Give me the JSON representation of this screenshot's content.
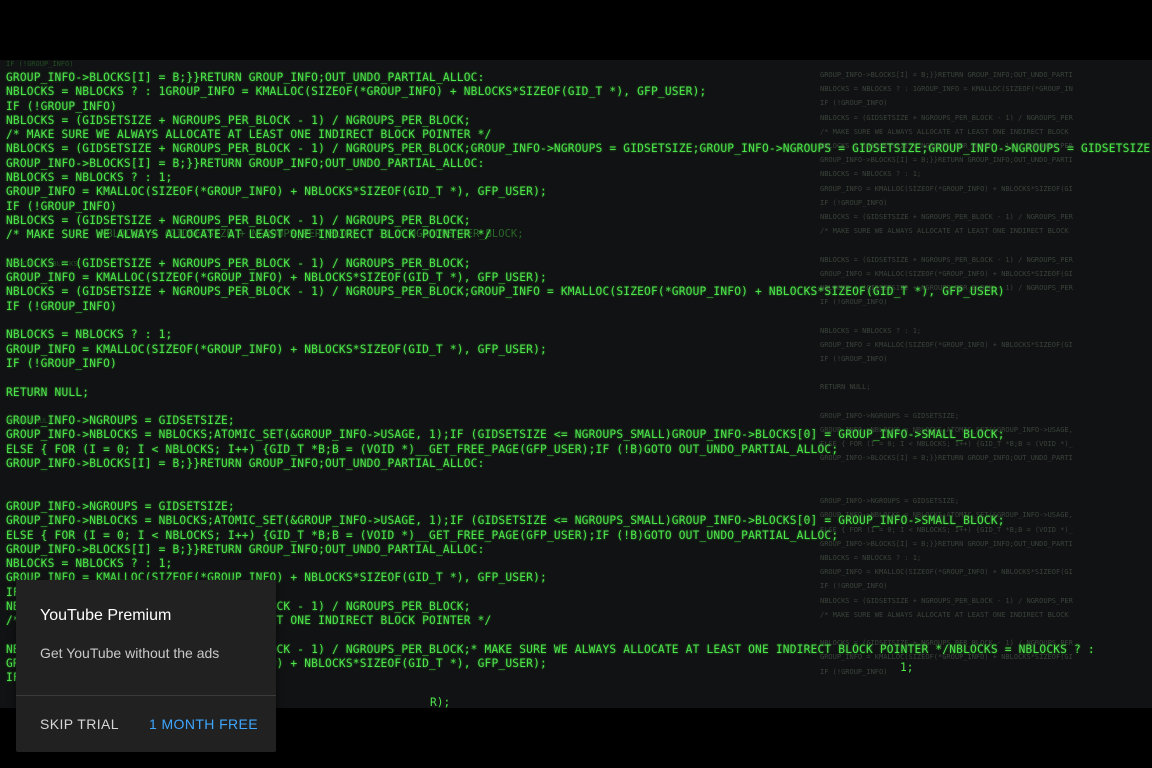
{
  "video": {
    "code_lines": [
      "GROUP_INFO->BLOCKS[I] = B;}}RETURN GROUP_INFO;OUT_UNDO_PARTIAL_ALLOC:",
      "NBLOCKS = NBLOCKS ? : 1GROUP_INFO = KMALLOC(SIZEOF(*GROUP_INFO) + NBLOCKS*SIZEOF(GID_T *), GFP_USER);",
      "IF (!GROUP_INFO)",
      "NBLOCKS = (GIDSETSIZE + NGROUPS_PER_BLOCK - 1) / NGROUPS_PER_BLOCK;",
      "/* MAKE SURE WE ALWAYS ALLOCATE AT LEAST ONE INDIRECT BLOCK POINTER */",
      "NBLOCKS = (GIDSETSIZE + NGROUPS_PER_BLOCK - 1) / NGROUPS_PER_BLOCK;GROUP_INFO->NGROUPS = GIDSETSIZE;GROUP_INFO->NGROUPS = GIDSETSIZE;GROUP_INFO->NGROUPS = GIDSETSIZE;",
      "GROUP_INFO->BLOCKS[I] = B;}}RETURN GROUP_INFO;OUT_UNDO_PARTIAL_ALLOC:",
      "NBLOCKS = NBLOCKS ? : 1;",
      "GROUP_INFO = KMALLOC(SIZEOF(*GROUP_INFO) + NBLOCKS*SIZEOF(GID_T *), GFP_USER);",
      "IF (!GROUP_INFO)",
      "NBLOCKS = (GIDSETSIZE + NGROUPS_PER_BLOCK - 1) / NGROUPS_PER_BLOCK;",
      "/* MAKE SURE WE ALWAYS ALLOCATE AT LEAST ONE INDIRECT BLOCK POINTER */",
      "",
      "NBLOCKS = (GIDSETSIZE + NGROUPS_PER_BLOCK - 1) / NGROUPS_PER_BLOCK;",
      "GROUP_INFO = KMALLOC(SIZEOF(*GROUP_INFO) + NBLOCKS*SIZEOF(GID_T *), GFP_USER);",
      "NBLOCKS = (GIDSETSIZE + NGROUPS_PER_BLOCK - 1) / NGROUPS_PER_BLOCK;GROUP_INFO = KMALLOC(SIZEOF(*GROUP_INFO) + NBLOCKS*SIZEOF(GID_T *), GFP_USER)",
      "IF (!GROUP_INFO)",
      "",
      "NBLOCKS = NBLOCKS ? : 1;",
      "GROUP_INFO = KMALLOC(SIZEOF(*GROUP_INFO) + NBLOCKS*SIZEOF(GID_T *), GFP_USER);",
      "IF (!GROUP_INFO)",
      "",
      "RETURN NULL;",
      "",
      "GROUP_INFO->NGROUPS = GIDSETSIZE;",
      "GROUP_INFO->NBLOCKS = NBLOCKS;ATOMIC_SET(&GROUP_INFO->USAGE, 1);IF (GIDSETSIZE <= NGROUPS_SMALL)GROUP_INFO->BLOCKS[0] = GROUP_INFO->SMALL_BLOCK;",
      "ELSE { FOR (I = 0; I < NBLOCKS; I++) {GID_T *B;B = (VOID *)__GET_FREE_PAGE(GFP_USER);IF (!B)GOTO OUT_UNDO_PARTIAL_ALLOC;",
      "GROUP_INFO->BLOCKS[I] = B;}}RETURN GROUP_INFO;OUT_UNDO_PARTIAL_ALLOC:",
      "",
      "",
      "GROUP_INFO->NGROUPS = GIDSETSIZE;",
      "GROUP_INFO->NBLOCKS = NBLOCKS;ATOMIC_SET(&GROUP_INFO->USAGE, 1);IF (GIDSETSIZE <= NGROUPS_SMALL)GROUP_INFO->BLOCKS[0] = GROUP_INFO->SMALL_BLOCK;",
      "ELSE { FOR (I = 0; I < NBLOCKS; I++) {GID_T *B;B = (VOID *)__GET_FREE_PAGE(GFP_USER);IF (!B)GOTO OUT_UNDO_PARTIAL_ALLOC;",
      "GROUP_INFO->BLOCKS[I] = B;}}RETURN GROUP_INFO;OUT_UNDO_PARTIAL_ALLOC:",
      "NBLOCKS = NBLOCKS ? : 1;",
      "GROUP_INFO = KMALLOC(SIZEOF(*GROUP_INFO) + NBLOCKS*SIZEOF(GID_T *), GFP_USER);",
      "IF (!GROUP_INFO)",
      "NBLOCKS = (GIDSETSIZE + NGROUPS_PER_BLOCK - 1) / NGROUPS_PER_BLOCK;",
      "/* MAKE SURE WE ALWAYS ALLOCATE AT LEAST ONE INDIRECT BLOCK POINTER */",
      "",
      "NBLOCKS = (GIDSETSIZE + NGROUPS_PER_BLOCK - 1) / NGROUPS_PER_BLOCK;* MAKE SURE WE ALWAYS ALLOCATE AT LEAST ONE INDIRECT BLOCK POINTER */NBLOCKS = NBLOCKS ? :",
      "GROUP_INFO = KMALLOC(SIZEOF(*GROUP_INFO) + NBLOCKS*SIZEOF(GID_T *), GFP_USER);",
      "IF (!GROUP_INFO)"
    ],
    "ghost_lines": [
      {
        "text": "IF (!GROUP_INFO)"
      },
      {
        "text": "NBLOCKS = NBLOCKS ? : 1;"
      },
      {
        "text": "NBLOCKS = (GIDSETSIZE + NGROUPS_PER_BLOCK - 1) / NGROUPS_PER_BLOCK;"
      },
      {
        "text": "RETURN NULL;"
      }
    ],
    "stray_texts": [
      {
        "text": "1;"
      },
      {
        "text": "R);"
      }
    ]
  },
  "promo": {
    "title": "YouTube Premium",
    "subtitle": "Get YouTube without the ads",
    "skip_label": "SKIP TRIAL",
    "free_label": "1 MONTH FREE",
    "accent_color": "#3ea6ff"
  }
}
